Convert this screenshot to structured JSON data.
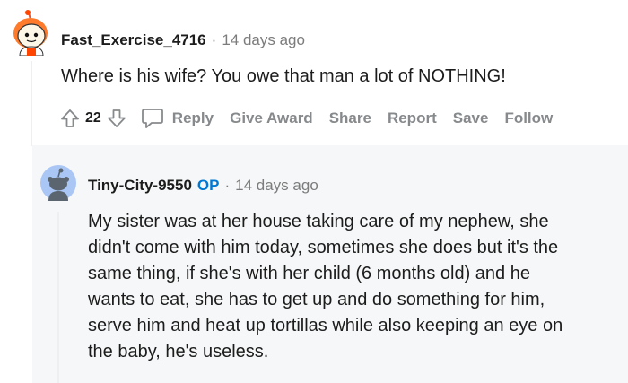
{
  "comment": {
    "author": "Fast_Exercise_4716",
    "separator": "·",
    "time": "14 days ago",
    "text": "Where is his wife? You owe that man a lot of NOTHING!",
    "score": "22",
    "avatar_icon": "snoo-avatar-icon",
    "actions": {
      "reply": "Reply",
      "give_award": "Give Award",
      "share": "Share",
      "report": "Report",
      "save": "Save",
      "follow": "Follow"
    }
  },
  "reply": {
    "author": "Tiny-City-9550",
    "op_badge": "OP",
    "separator": "·",
    "time": "14 days ago",
    "avatar_icon": "default-snoo-avatar-icon",
    "lines": [
      "My sister was at her house taking care of my nephew, she",
      "didn't come with him today, sometimes she does but it's the",
      "same thing, if she's with her child (6 months old) and he",
      "wants to eat, she has to get up and do something for him,",
      "serve him and heat up tortillas while also keeping an eye on",
      "the baby, he's useless."
    ]
  },
  "colors": {
    "text": "#1c1c1c",
    "meta": "#7c7c7c",
    "action": "#878a8c",
    "op": "#0079d3",
    "reply_bg": "#f6f7f8"
  }
}
